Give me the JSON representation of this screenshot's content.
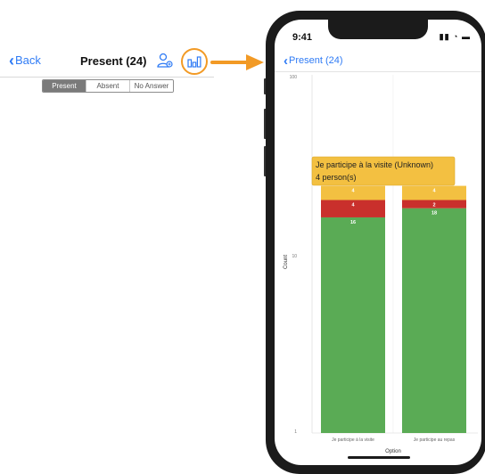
{
  "left": {
    "back_label": "Back",
    "title": "Present (24)",
    "segments": [
      "Present",
      "Absent",
      "No Answer"
    ]
  },
  "phone": {
    "time": "9:41",
    "back_label": "Present (24)"
  },
  "chart_data": {
    "type": "bar",
    "stacked": true,
    "ylabel": "Count",
    "xlabel": "Option",
    "y_scale": "log",
    "ylim": [
      1,
      100
    ],
    "yticks": [
      "100",
      "10",
      "1"
    ],
    "categories": [
      "Je participe à la visite",
      "Je participe au repas"
    ],
    "series": [
      {
        "values": [
          16,
          18
        ],
        "color": "#5aab55"
      },
      {
        "values": [
          4,
          2
        ],
        "color": "#c9302c"
      },
      {
        "values": [
          4,
          4
        ],
        "color": "#f3c041"
      }
    ],
    "tooltip": {
      "line1": "Je participe à la visite (Unknown)",
      "line2": "4 person(s)"
    }
  },
  "colors": {
    "accent": "#2f7bf5",
    "highlight": "#f29a25"
  }
}
